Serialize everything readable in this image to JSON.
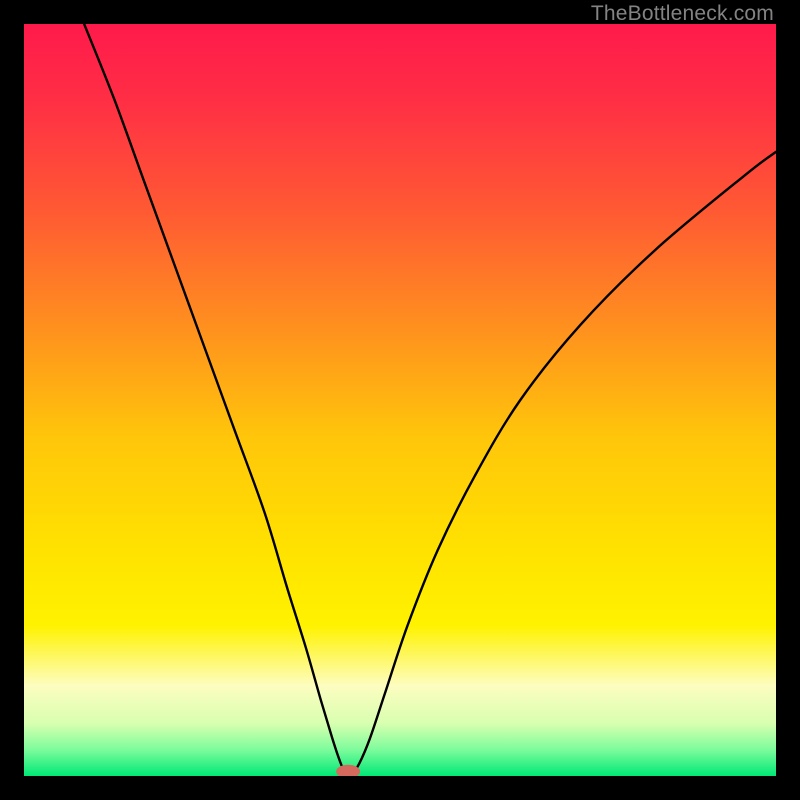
{
  "watermark": "TheBottleneck.com",
  "chart_data": {
    "type": "line",
    "title": "",
    "xlabel": "",
    "ylabel": "",
    "xlim": [
      0,
      100
    ],
    "ylim": [
      0,
      100
    ],
    "gradient_stops": [
      {
        "offset": 0.0,
        "color": "#ff1a4b"
      },
      {
        "offset": 0.1,
        "color": "#ff2e45"
      },
      {
        "offset": 0.25,
        "color": "#ff5a33"
      },
      {
        "offset": 0.4,
        "color": "#ff8f1f"
      },
      {
        "offset": 0.55,
        "color": "#ffc60a"
      },
      {
        "offset": 0.7,
        "color": "#ffe200"
      },
      {
        "offset": 0.8,
        "color": "#fff200"
      },
      {
        "offset": 0.88,
        "color": "#fdfdc0"
      },
      {
        "offset": 0.93,
        "color": "#d8ffb0"
      },
      {
        "offset": 0.965,
        "color": "#7dfc9c"
      },
      {
        "offset": 1.0,
        "color": "#00e876"
      }
    ],
    "series": [
      {
        "name": "curve",
        "x": [
          8,
          12,
          16,
          20,
          24,
          28,
          32,
          35,
          37.5,
          39.5,
          41,
          42,
          42.8,
          43.5,
          44.5,
          46,
          48,
          51,
          55,
          60,
          66,
          74,
          84,
          96,
          100
        ],
        "y": [
          100,
          90,
          79,
          68,
          57,
          46,
          35,
          25,
          17,
          10,
          5,
          2,
          0.2,
          0.2,
          1.5,
          5,
          11,
          20,
          30,
          40,
          50,
          60,
          70,
          80,
          83
        ]
      }
    ],
    "marker": {
      "x": 43.1,
      "y": 0.6,
      "rx": 1.6,
      "ry": 0.9,
      "color": "#d46a5e"
    }
  }
}
